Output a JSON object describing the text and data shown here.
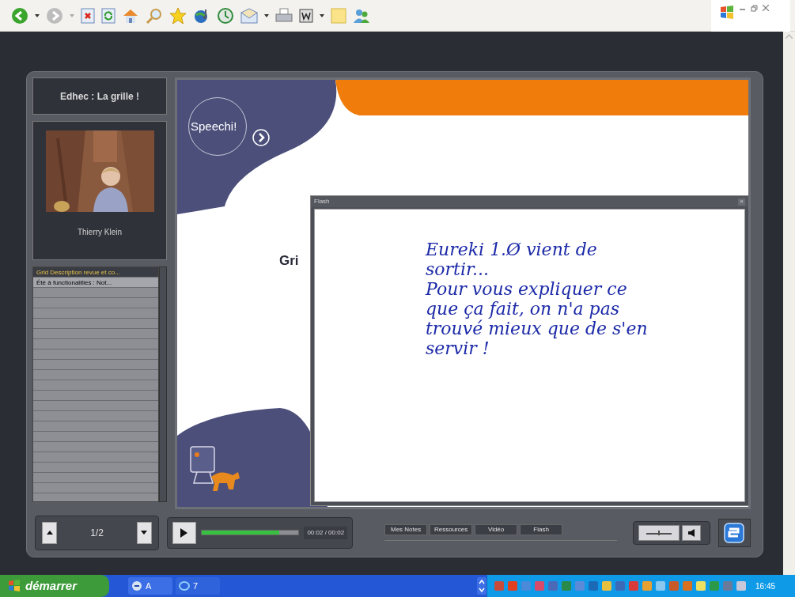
{
  "player": {
    "title": "Edhec : La grille !",
    "presenter": {
      "name": "Thierry Klein"
    },
    "chapters": [
      {
        "label": "Grid Description revue et co...",
        "selected": true
      },
      {
        "label": "Été à  functionalities : Not...",
        "selected": false
      }
    ],
    "slide": {
      "brand": "Speechi!",
      "heading": "Gri"
    },
    "flash_window": {
      "title": "Flash",
      "close": "×",
      "note": [
        "Eureki 1.Ø vient de",
        "sortir...",
        "Pour vous expliquer ce",
        "que ça fait, on n'a pas",
        "trouvé mieux que de s'en",
        "servir !"
      ]
    },
    "page_counter": "1/2",
    "playback": {
      "level": 0.8,
      "time": "00:02 / 00:02"
    },
    "tabs": [
      "Mes Notes",
      "Ressources",
      "Vidéo",
      "Flash"
    ]
  },
  "taskbar": {
    "start": "démarrer",
    "tasks": [
      {
        "label": "A"
      },
      {
        "label": "7"
      }
    ],
    "clock": "16:45"
  }
}
